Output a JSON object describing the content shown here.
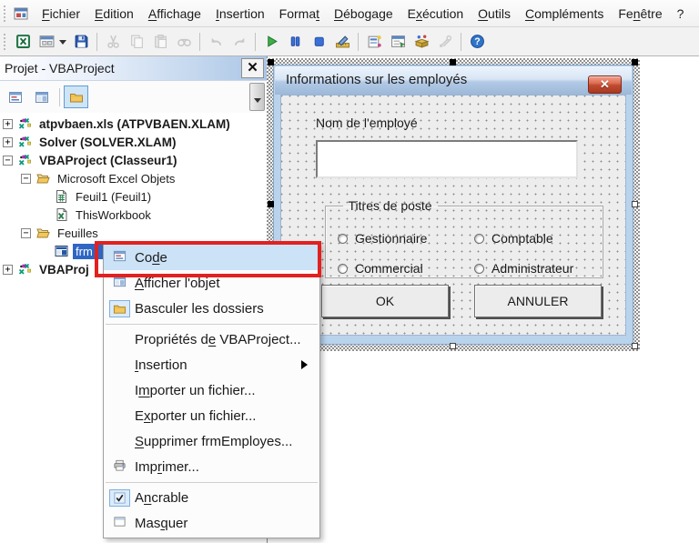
{
  "colors": {
    "annotation_red": "#e3201f",
    "selection_blue": "#2e66c4",
    "menu_highlight": "#cbe2f7",
    "titlebar_blue_light": "#ecf3fc",
    "titlebar_blue_dark": "#9cb8d9",
    "close_button_red": "#c04a30",
    "form_frame_blue": "#b9d3ec"
  },
  "menu_bar": {
    "app_icon": "userform-window-icon",
    "items": [
      {
        "name": "fichier",
        "pre": "",
        "key": "F",
        "post": "ichier"
      },
      {
        "name": "edition",
        "pre": "",
        "key": "E",
        "post": "dition"
      },
      {
        "name": "affichage",
        "pre": "",
        "key": "A",
        "post": "ffichage"
      },
      {
        "name": "insertion",
        "pre": "",
        "key": "I",
        "post": "nsertion"
      },
      {
        "name": "format",
        "pre": "Forma",
        "key": "t",
        "post": ""
      },
      {
        "name": "debogage",
        "pre": "",
        "key": "D",
        "post": "ébogage"
      },
      {
        "name": "execution",
        "pre": "E",
        "key": "x",
        "post": "écution"
      },
      {
        "name": "outils",
        "pre": "",
        "key": "O",
        "post": "utils"
      },
      {
        "name": "complements",
        "pre": "",
        "key": "C",
        "post": "ompléments"
      },
      {
        "name": "fenetre",
        "pre": "Fe",
        "key": "n",
        "post": "être"
      },
      {
        "name": "aide",
        "pre": "?",
        "key": "",
        "post": ""
      }
    ]
  },
  "toolbar": {
    "items": [
      {
        "name": "excel-icon",
        "enabled": true
      },
      {
        "name": "insert-userform-icon",
        "enabled": true,
        "dropdown": true
      },
      {
        "name": "save-icon",
        "enabled": true
      },
      {
        "type": "separator"
      },
      {
        "name": "cut-icon",
        "enabled": false
      },
      {
        "name": "copy-icon",
        "enabled": false
      },
      {
        "name": "paste-icon",
        "enabled": false
      },
      {
        "name": "find-icon",
        "enabled": false
      },
      {
        "type": "separator"
      },
      {
        "name": "undo-icon",
        "enabled": false
      },
      {
        "name": "redo-icon",
        "enabled": false
      },
      {
        "type": "separator"
      },
      {
        "name": "run-icon",
        "enabled": true
      },
      {
        "name": "break-icon",
        "enabled": true
      },
      {
        "name": "reset-icon",
        "enabled": true
      },
      {
        "name": "design-mode-icon",
        "enabled": true
      },
      {
        "type": "separator"
      },
      {
        "name": "project-explorer-icon",
        "enabled": true
      },
      {
        "name": "properties-window-icon",
        "enabled": true
      },
      {
        "name": "object-browser-icon",
        "enabled": true
      },
      {
        "name": "toolbox-icon",
        "enabled": false
      },
      {
        "type": "separator"
      },
      {
        "name": "help-icon",
        "enabled": true
      }
    ]
  },
  "project_panel": {
    "title": "Projet - VBAProject",
    "close_glyph": "✕",
    "tools": [
      {
        "name": "view-code",
        "icon": "view-code-icon",
        "selected": false
      },
      {
        "name": "view-object",
        "icon": "view-object-icon",
        "selected": false
      },
      {
        "name": "toggle-folders",
        "icon": "toggle-folders-icon",
        "selected": true
      }
    ],
    "tree": [
      {
        "name": "atpvbaen",
        "label": "atpvbaen.xls (ATPVBAEN.XLAM)",
        "icon": "project-icon",
        "level": 0,
        "expand": "+",
        "bold": true
      },
      {
        "name": "solver",
        "label": "Solver (SOLVER.XLAM)",
        "icon": "project-icon",
        "level": 0,
        "expand": "+",
        "bold": true
      },
      {
        "name": "vbaproject-classeur1",
        "label": "VBAProject (Classeur1)",
        "icon": "project-icon",
        "level": 0,
        "expand": "-",
        "bold": true
      },
      {
        "name": "microsoft-excel-objets",
        "label": "Microsoft Excel Objets",
        "icon": "folder-open-icon",
        "level": 1,
        "expand": "-"
      },
      {
        "name": "feuil1",
        "label": "Feuil1 (Feuil1)",
        "icon": "sheet-icon",
        "level": 2
      },
      {
        "name": "thisworkbook",
        "label": "ThisWorkbook",
        "icon": "workbook-icon",
        "level": 2
      },
      {
        "name": "feuilles",
        "label": "Feuilles",
        "icon": "folder-open-icon",
        "level": 1,
        "expand": "-"
      },
      {
        "name": "frmemployes",
        "label": "frm",
        "icon": "form-icon",
        "level": 2,
        "selected": true
      },
      {
        "name": "vbaproject-2",
        "label": "VBAProj",
        "icon": "project-icon",
        "level": 0,
        "expand": "+",
        "bold": true
      }
    ]
  },
  "context_menu": {
    "items": [
      {
        "name": "code",
        "icon": "view-code-icon",
        "pre": "Co",
        "key": "d",
        "post": "e",
        "highlighted": true
      },
      {
        "name": "afficher-objet",
        "icon": "view-object-icon",
        "pre": "",
        "key": "A",
        "post": "fficher l'objet"
      },
      {
        "name": "basculer-dossiers",
        "icon": "toggle-folders-icon",
        "icon_box": true,
        "pre": "Basculer les dossiers",
        "key": "",
        "post": ""
      },
      {
        "type": "separator"
      },
      {
        "name": "proprietes-vbaproject",
        "pre": "Propriétés d",
        "key": "e",
        "post": " VBAProject..."
      },
      {
        "name": "insertion",
        "pre": "",
        "key": "I",
        "post": "nsertion",
        "submenu": true
      },
      {
        "name": "importer-fichier",
        "pre": "I",
        "key": "m",
        "post": "porter un fichier..."
      },
      {
        "name": "exporter-fichier",
        "pre": "E",
        "key": "x",
        "post": "porter un fichier..."
      },
      {
        "name": "supprimer-frmemployes",
        "pre": "",
        "key": "S",
        "post": "upprimer frmEmployes..."
      },
      {
        "name": "imprimer",
        "icon": "printer-icon",
        "pre": "Imp",
        "key": "r",
        "post": "imer..."
      },
      {
        "type": "separator"
      },
      {
        "name": "ancrable",
        "icon": "checkbox-checked-icon",
        "icon_box": true,
        "pre": "A",
        "key": "n",
        "post": "crable"
      },
      {
        "name": "masquer",
        "icon": "window-icon",
        "pre": "Mas",
        "key": "q",
        "post": "uer"
      }
    ]
  },
  "userform": {
    "title": "Informations sur les employés",
    "close_glyph": "✕",
    "name_label": "Nom de l'employé",
    "name_value": "",
    "frame_title": "Titres de poste",
    "radios": [
      {
        "name": "gestionnaire",
        "label": "Gestionnaire"
      },
      {
        "name": "comptable",
        "label": "Comptable"
      },
      {
        "name": "commercial",
        "label": "Commercial"
      },
      {
        "name": "administrateur",
        "label": "Administrateur"
      }
    ],
    "ok_label": "OK",
    "cancel_label": "ANNULER"
  }
}
